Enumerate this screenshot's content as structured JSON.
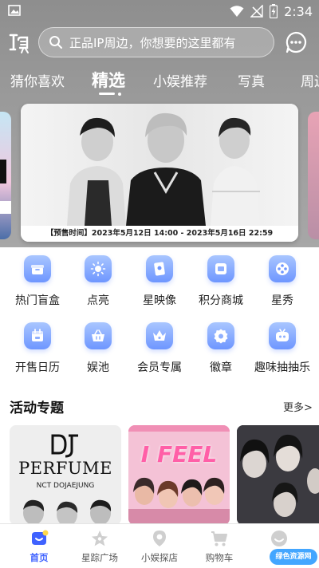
{
  "status_bar": {
    "time": "2:34"
  },
  "search": {
    "placeholder": "正品IP周边，你想要的这里都有"
  },
  "tabs": [
    {
      "label": "猜你喜欢",
      "active": false
    },
    {
      "label": "精选",
      "active": true
    },
    {
      "label": "小娱推荐",
      "active": false
    },
    {
      "label": "写真",
      "active": false
    },
    {
      "label": "周边",
      "active": false
    }
  ],
  "banner": {
    "caption": "【预售时间】2023年5月12日 14:00 - 2023年5月16日 22:59"
  },
  "categories": [
    {
      "label": "热门盲盒",
      "icon": "box-icon"
    },
    {
      "label": "点亮",
      "icon": "sun-icon"
    },
    {
      "label": "星映像",
      "icon": "photo-card-icon"
    },
    {
      "label": "积分商城",
      "icon": "points-card-icon"
    },
    {
      "label": "星秀",
      "icon": "film-reel-icon"
    },
    {
      "label": "开售日历",
      "icon": "calendar-icon"
    },
    {
      "label": "娱池",
      "icon": "basket-icon"
    },
    {
      "label": "会员专属",
      "icon": "crown-icon"
    },
    {
      "label": "徽章",
      "icon": "badge-gear-icon"
    },
    {
      "label": "趣味抽抽乐",
      "icon": "lottery-icon"
    }
  ],
  "section": {
    "title": "活动专题",
    "more": "更多>"
  },
  "cards": [
    {
      "logo": "DJ",
      "title": "PERFUME",
      "subtitle": "NCT DOJAEJUNG"
    },
    {
      "title": "I FEEL"
    },
    {
      "title": ""
    }
  ],
  "bottom_nav": [
    {
      "label": "首页",
      "icon": "home-icon",
      "active": true
    },
    {
      "label": "星踪广场",
      "icon": "star-icon",
      "active": false
    },
    {
      "label": "小娱探店",
      "icon": "location-pin-icon",
      "active": false
    },
    {
      "label": "购物车",
      "icon": "cart-icon",
      "active": false
    },
    {
      "label": "",
      "icon": "profile-icon",
      "active": false
    }
  ],
  "watermark": "绿色资源网",
  "colors": {
    "accent": "#3f62ff",
    "icon_gradient_top": "#a9c6ff",
    "icon_gradient_bottom": "#6e96ff"
  }
}
